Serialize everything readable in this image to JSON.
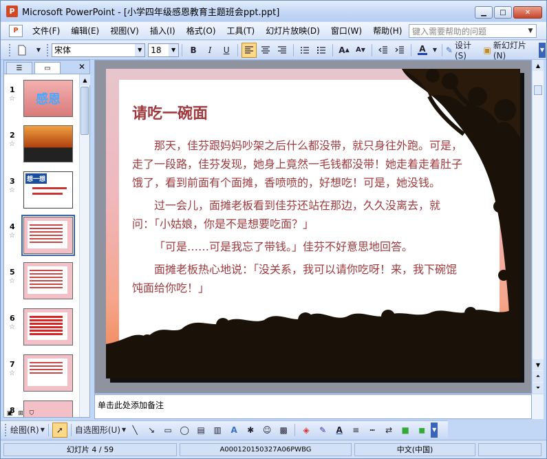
{
  "window": {
    "title": "Microsoft PowerPoint - [小学四年级感恩教育主题班会ppt.ppt]",
    "minimize": "▁",
    "maximize": "□",
    "close": "✕"
  },
  "menu": {
    "items": [
      "文件(F)",
      "编辑(E)",
      "视图(V)",
      "插入(I)",
      "格式(O)",
      "工具(T)",
      "幻灯片放映(D)",
      "窗口(W)",
      "帮助(H)"
    ],
    "help_placeholder": "键入需要帮助的问题"
  },
  "toolbar": {
    "font_name": "宋体",
    "font_size": "18",
    "bold": "B",
    "italic": "I",
    "underline": "U",
    "design_label": "设计(S)",
    "new_slide_label": "新幻灯片(N)"
  },
  "thumbnails": [
    {
      "num": "1",
      "text": "感恩"
    },
    {
      "num": "2",
      "text": ""
    },
    {
      "num": "3",
      "text": "想一想"
    },
    {
      "num": "4",
      "text": ""
    },
    {
      "num": "5",
      "text": ""
    },
    {
      "num": "6",
      "text": ""
    },
    {
      "num": "7",
      "text": ""
    },
    {
      "num": "8",
      "text": ""
    }
  ],
  "slide": {
    "title": "请吃一碗面",
    "paragraphs": [
      "那天，佳芬跟妈妈吵架之后什么都没带，就只身往外跑。可是，走了一段路，佳芬发现，她身上竟然一毛钱都没带！她走着走着肚子饿了，看到前面有个面摊，香喷喷的，好想吃！可是，她没钱。",
      "过一会儿，面摊老板看到佳芬还站在那边，久久没离去，就问：「小姑娘，你是不是想要吃面？」",
      "「可是……可是我忘了带钱。」佳芬不好意思地回答。",
      "面摊老板热心地说：「没关系，我可以请你吃呀！来，我下碗馄饨面给你吃！」"
    ]
  },
  "notes": {
    "placeholder": "单击此处添加备注"
  },
  "drawing_toolbar": {
    "draw_label": "绘图(R)",
    "autoshapes_label": "自选图形(U)"
  },
  "status": {
    "slide_indicator": "幻灯片 4 / 59",
    "template": "A000120150327A06PWBG",
    "language": "中文(中国)"
  },
  "colors": {
    "slide_text": "#a0393d",
    "ui_blue": "#c2d6f5"
  }
}
